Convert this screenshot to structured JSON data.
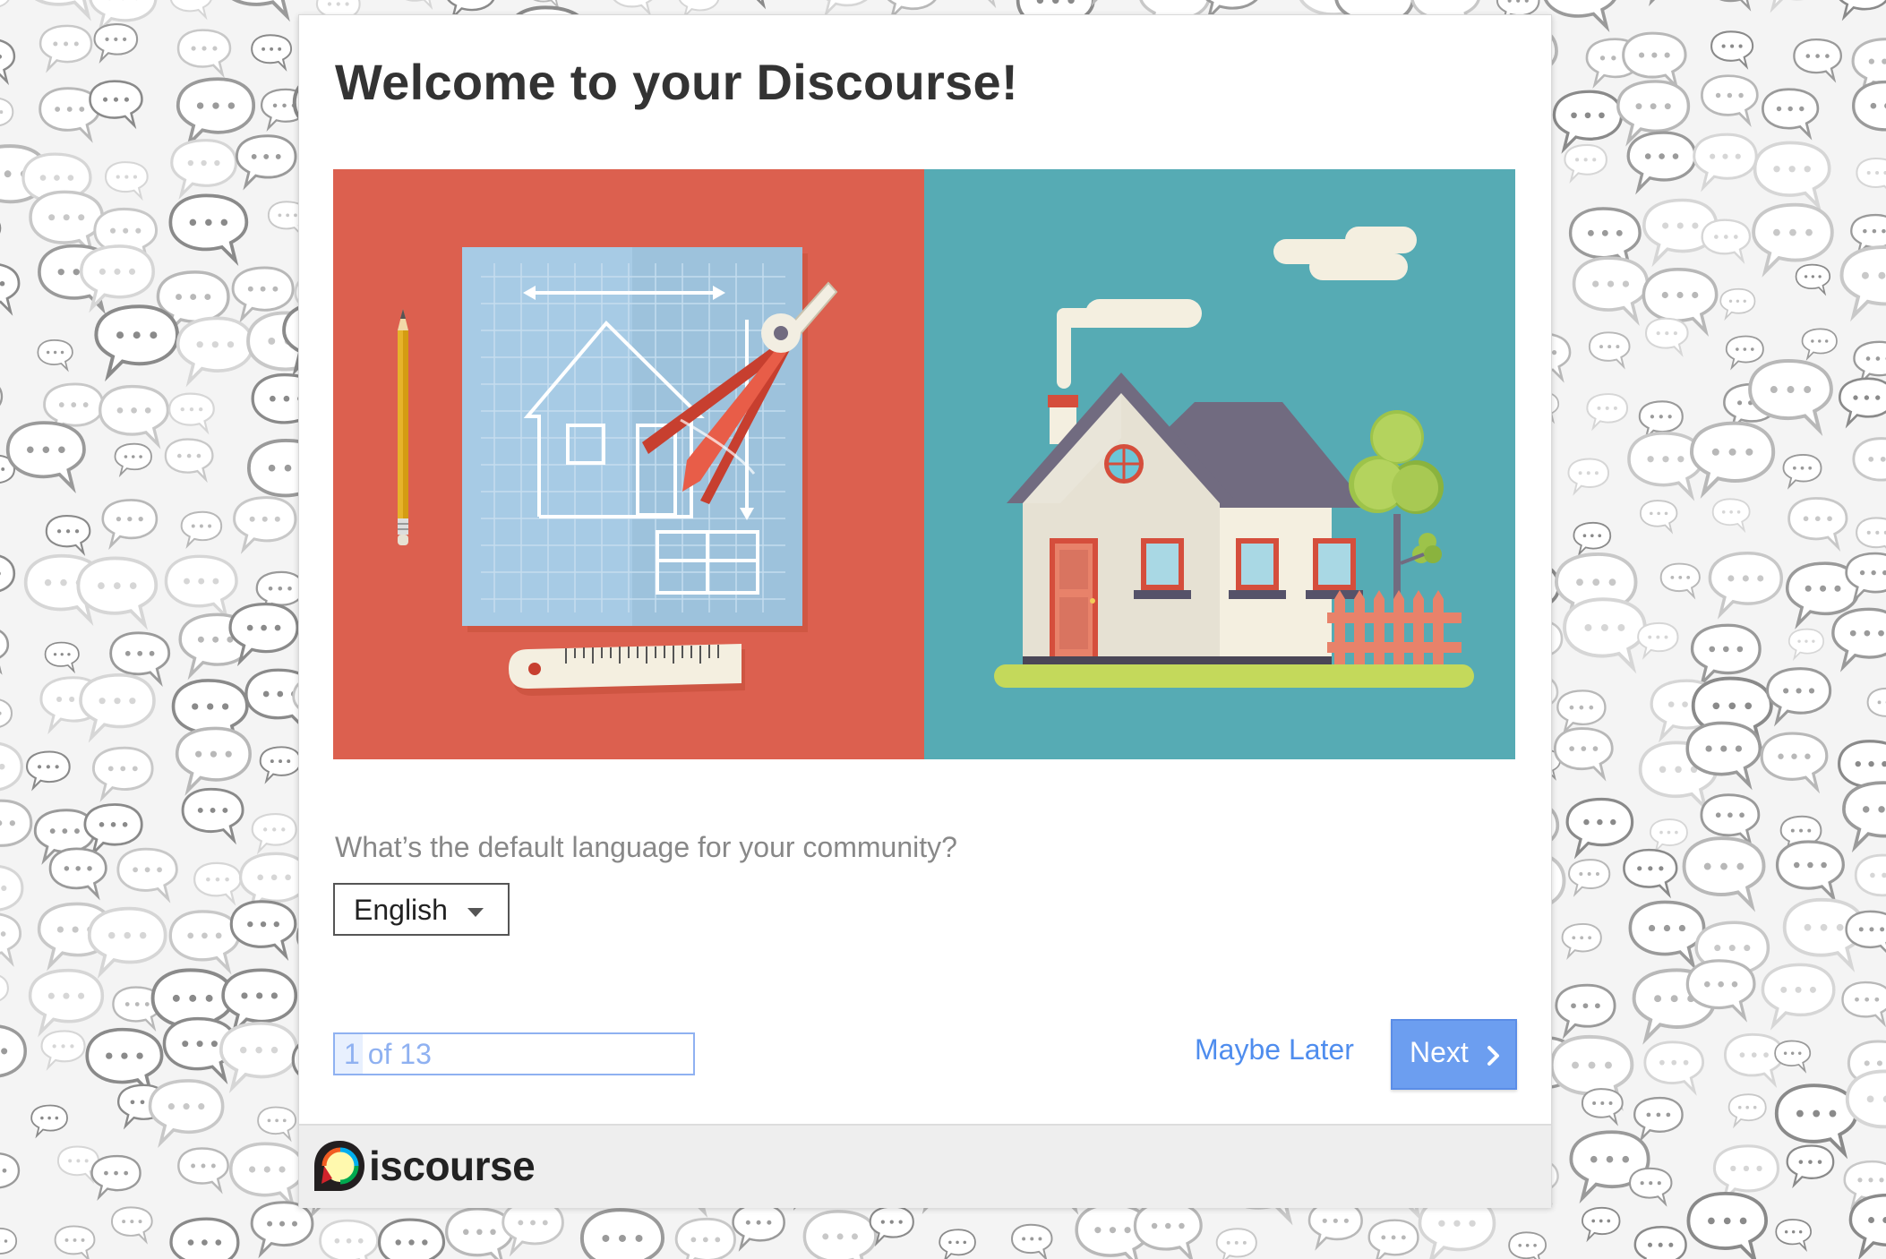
{
  "wizard": {
    "title": "Welcome to your Discourse!",
    "language_prompt": "What’s the default language for your community?",
    "language_selected": "English",
    "progress_text": "1 of 13",
    "progress": {
      "current": 1,
      "total": 13
    },
    "maybe_later_label": "Maybe Later",
    "next_label": "Next"
  },
  "footer": {
    "logo_text": "iscourse"
  },
  "icons": {
    "dropdown": "caret-down-icon",
    "next": "chevron-right-icon",
    "logo": "discourse-logo-icon",
    "background": "speech-bubble-pattern"
  },
  "colors": {
    "accent": "#6c9ef0",
    "link": "#4f8dee",
    "hero_left": "#dc604f",
    "hero_right": "#56abb4",
    "blueprint": "#a7cbe5",
    "roof": "#716b80",
    "grass": "#c4d95b"
  }
}
